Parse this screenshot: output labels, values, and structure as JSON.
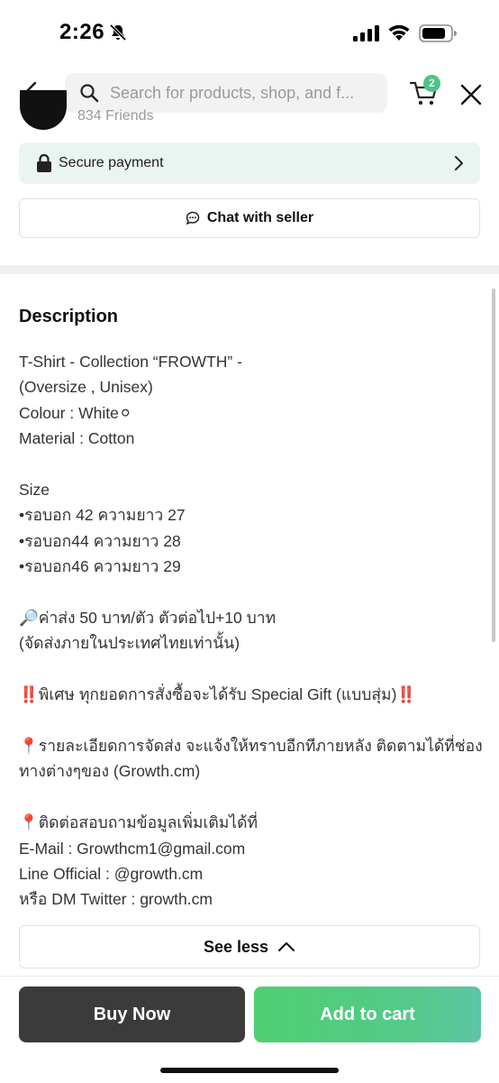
{
  "status_bar": {
    "time": "2:26",
    "icons": [
      "bell-slash-icon",
      "cellular-signal-icon",
      "wifi-icon",
      "battery-icon"
    ]
  },
  "header": {
    "search_placeholder": "Search for products, shop, and f...",
    "cart_count": "2",
    "icons": [
      "back-chevron-icon",
      "search-icon",
      "cart-icon",
      "close-icon"
    ]
  },
  "shop": {
    "friends": "834 Friends"
  },
  "secure_payment": {
    "label": "Secure payment"
  },
  "chat": {
    "label": "Chat with seller"
  },
  "description": {
    "title": "Description",
    "lines": [
      "T-Shirt - Collection “FROWTH” -",
      "(Oversize , Unisex)",
      "Colour : White⚪",
      "Material : Cotton",
      "",
      "Size",
      "•รอบอก 42 ความยาว 27",
      "•รอบอก44 ความยาว 28",
      "•รอบอก46 ความยาว 29",
      "",
      "🔎ค่าส่ง 50 บาท/ตัว ตัวต่อไป+10 บาท",
      "(จัดส่งภายในประเทศไทยเท่านั้น)",
      "",
      "‼️พิเศษ ทุกยอดการสั่งซื้อจะได้รับ Special Gift (แบบสุ่ม)‼️",
      "",
      "📍รายละเอียดการจัดส่ง จะแจ้งให้ทราบอีกทีภายหลัง ติดตามได้ที่ช่องทางต่างๆของ (Growth.cm)",
      "",
      "📍ติดต่อสอบถามข้อมูลเพิ่มเติมได้ที่",
      "E-Mail : Growthcm1@gmail.com",
      "Line Official : @growth.cm",
      "หรือ DM Twitter : growth.cm"
    ],
    "see_less_label": "See less"
  },
  "actions": {
    "buy_now": "Buy Now",
    "add_to_cart": "Add to cart"
  },
  "colors": {
    "accent_green": "#4fcf72",
    "secure_bg": "#eaf4f1",
    "buy_now_bg": "#3b3b3b",
    "badge_green": "#4cc488"
  }
}
